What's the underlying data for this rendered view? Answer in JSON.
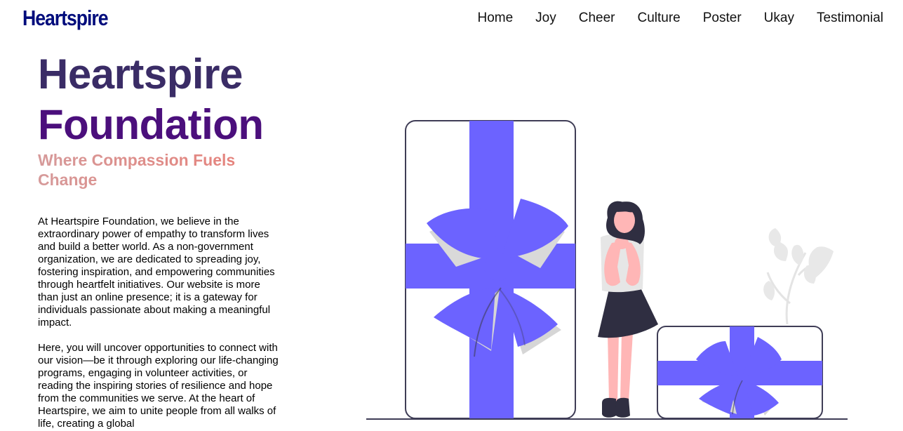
{
  "nav": {
    "brand": "Heartspire",
    "links": [
      "Home",
      "Joy",
      "Cheer",
      "Culture",
      "Poster",
      "Ukay",
      "Testimonial"
    ]
  },
  "hero": {
    "title_line1": "Heartspire",
    "title_line2": "Foundation",
    "tagline": "Where Compassion Fuels Change",
    "paragraph1": "At Heartspire Foundation, we believe in the extraordinary power of empathy to transform lives and build a better world. As a non-government organization, we are dedicated to spreading joy, fostering inspiration, and empowering communities through heartfelt initiatives. Our website is more than just an online presence; it is a gateway for individuals passionate about making a meaningful impact.",
    "paragraph2": "Here, you will uncover opportunities to connect with our vision—be it through exploring our life-changing programs, engaging in volunteer activities, or reading the inspiring stories of resilience and hope from the communities we serve. At the heart of Heartspire, we aim to unite people from all walks of life, creating a global"
  },
  "colors": {
    "brand": "#000c7c",
    "accent": "#6c63ff",
    "title_dark": "#3a2c66",
    "title_purple": "#4b0f7c",
    "tagline": "#e88078",
    "skin": "#ffb6b6",
    "dark": "#2f2e41"
  }
}
